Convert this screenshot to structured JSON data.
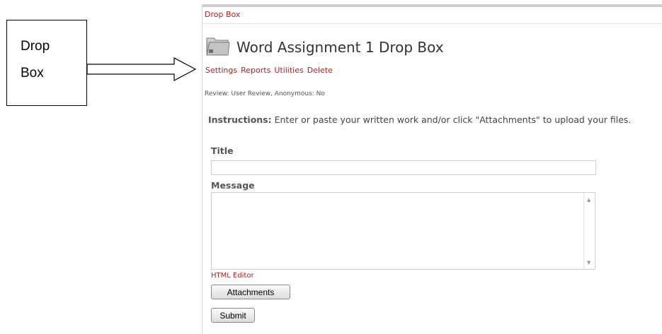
{
  "callout": {
    "text": "Drop\nBox"
  },
  "breadcrumb": "Drop Box",
  "page": {
    "title": "Word Assignment 1 Drop Box",
    "icon": "folder-icon"
  },
  "context_menu": [
    "Settings",
    "Reports",
    "Utilities",
    "Delete"
  ],
  "info_line": "Review: User Review, Anonymous: No",
  "instructions": {
    "label": "Instructions:",
    "text": " Enter or paste your written work and/or click \"Attachments\" to upload your files."
  },
  "form": {
    "title_label": "Title",
    "title_value": "",
    "message_label": "Message",
    "message_value": "",
    "html_editor_link": "HTML Editor",
    "attachments_button": "Attachments",
    "submit_button": "Submit"
  },
  "colors": {
    "link": "#b22222",
    "text": "#444444",
    "border": "#cfcfcf"
  }
}
